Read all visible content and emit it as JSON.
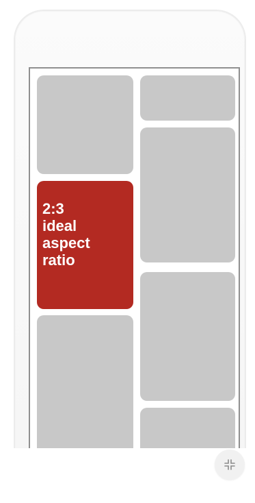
{
  "diagram": {
    "highlight_label": "2:3\nideal\naspect\nratio",
    "tiles_gray_color": "#c8c8c8",
    "highlight_color": "#b32a22"
  },
  "controls": {
    "collapse_icon": "collapse-icon"
  }
}
